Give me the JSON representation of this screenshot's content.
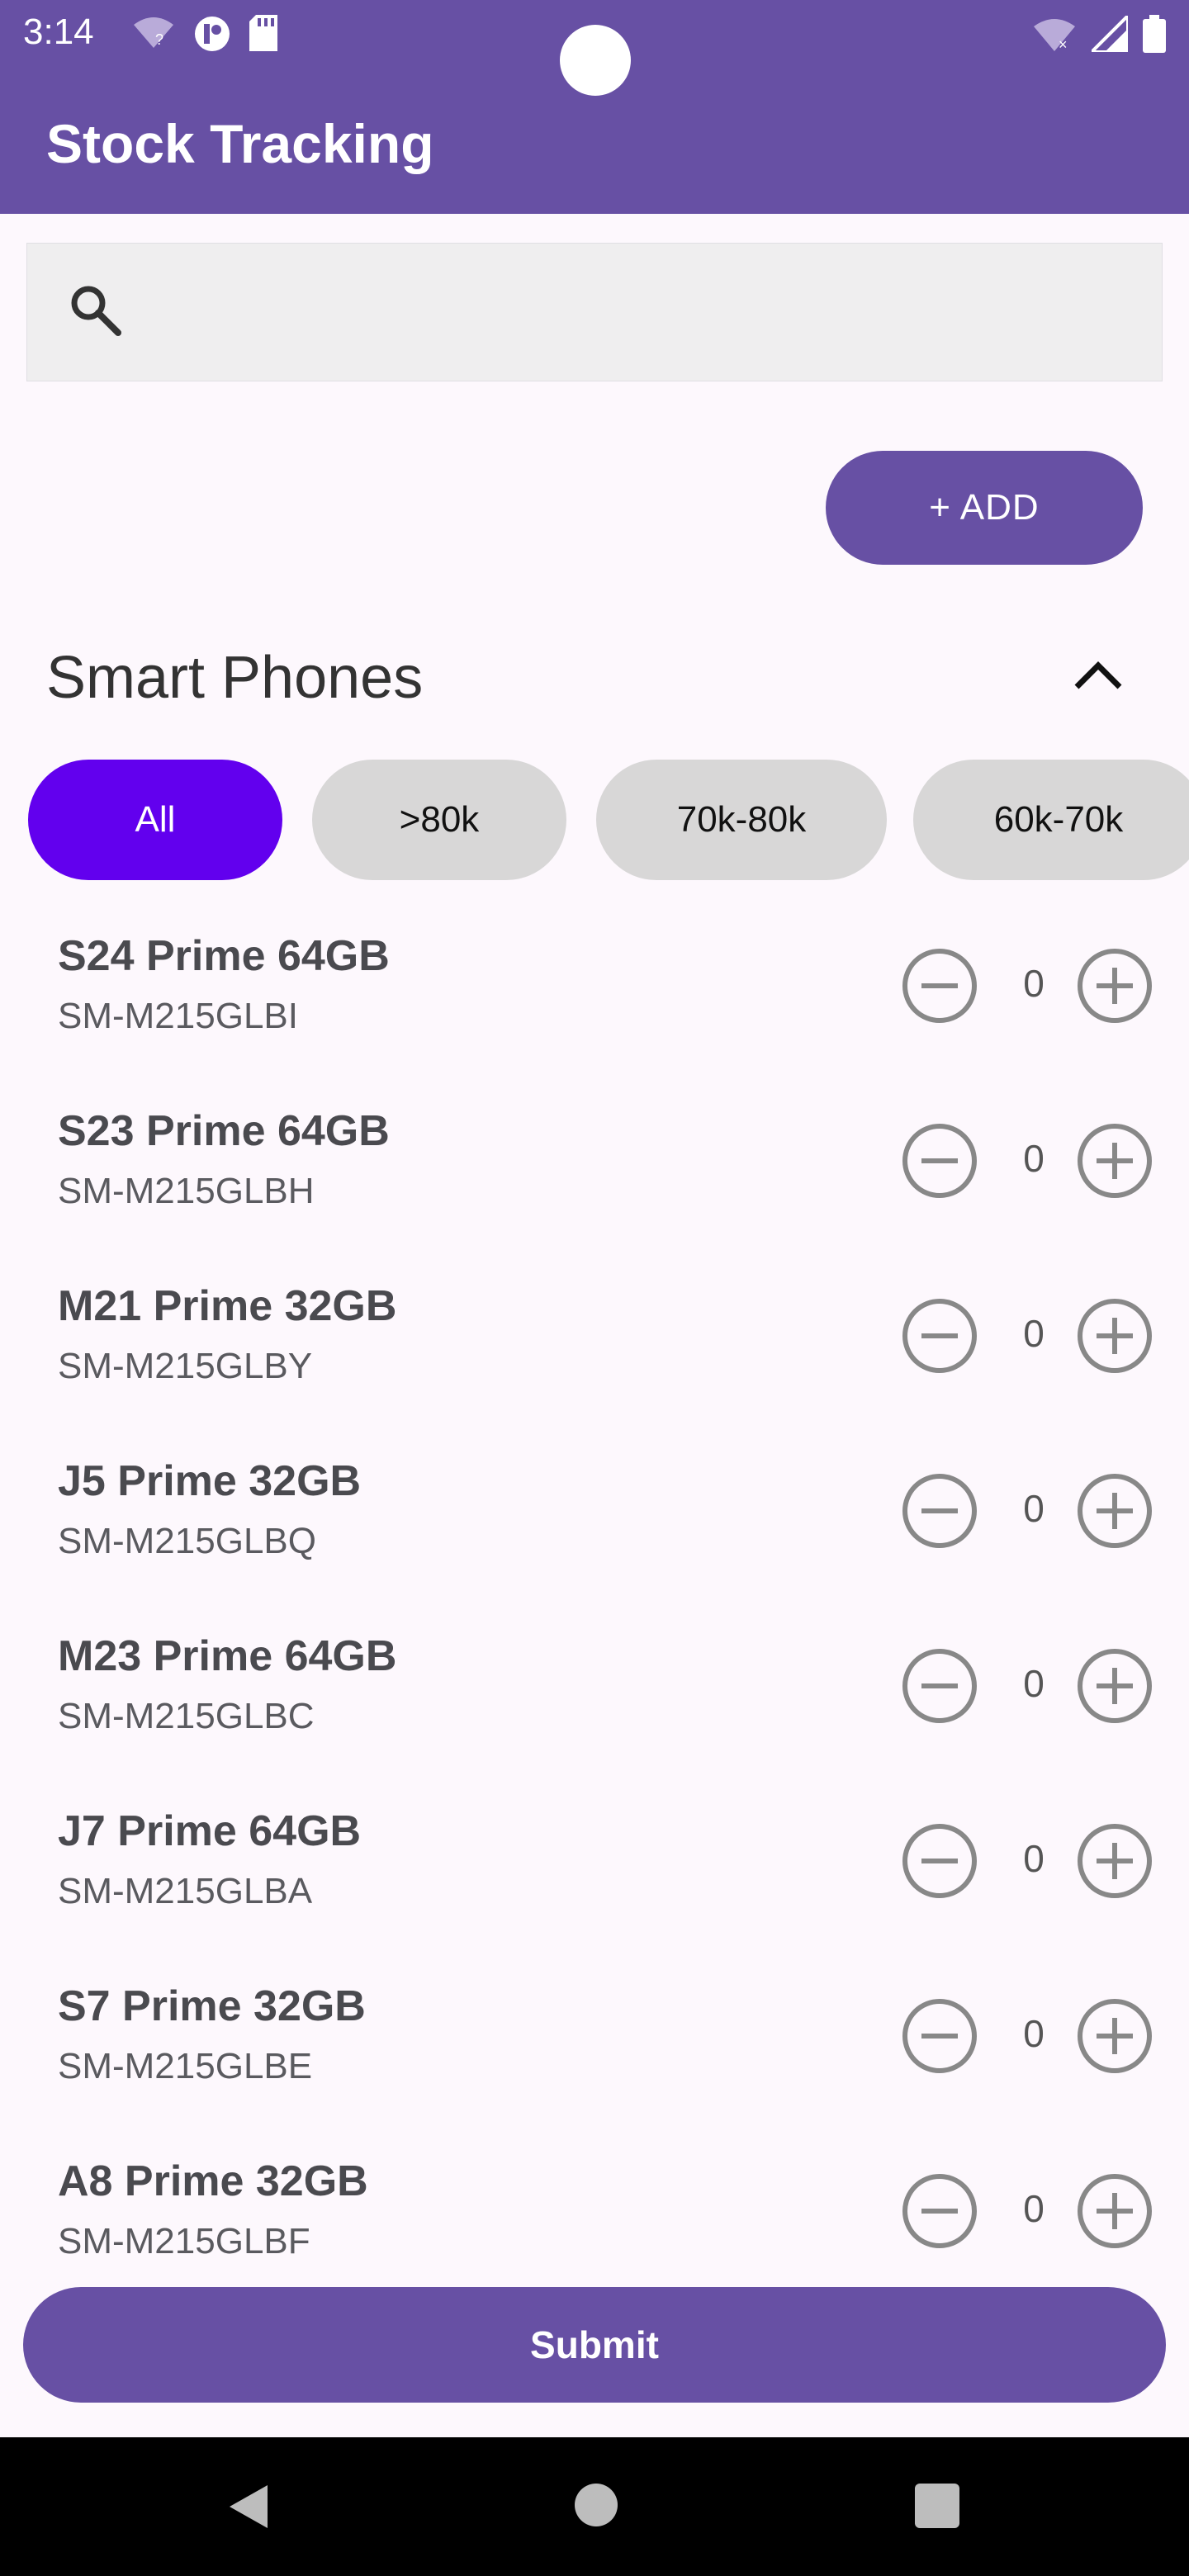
{
  "status_bar": {
    "time": "3:14",
    "icons_left": [
      "wifi-question-icon",
      "app-badge-icon",
      "sd-card-icon"
    ],
    "icons_right": [
      "wifi-off-icon",
      "signal-icon",
      "battery-icon"
    ]
  },
  "app_bar": {
    "title": "Stock Tracking",
    "color": "#6750a4"
  },
  "search": {
    "placeholder": "",
    "value": ""
  },
  "add_button": {
    "label": "+ ADD"
  },
  "section": {
    "title": "Smart Phones",
    "expanded": true
  },
  "filters": {
    "chips": [
      {
        "label": "All",
        "selected": true
      },
      {
        "label": ">80k",
        "selected": false
      },
      {
        "label": "70k-80k",
        "selected": false
      },
      {
        "label": "60k-70k",
        "selected": false
      }
    ],
    "active_color": "#6200ee"
  },
  "products": [
    {
      "name": "S24 Prime 64GB",
      "sku": "SM-M215GLBI",
      "qty": "0"
    },
    {
      "name": "S23 Prime 64GB",
      "sku": "SM-M215GLBH",
      "qty": "0"
    },
    {
      "name": "M21 Prime 32GB",
      "sku": "SM-M215GLBY",
      "qty": "0"
    },
    {
      "name": "J5 Prime 32GB",
      "sku": "SM-M215GLBQ",
      "qty": "0"
    },
    {
      "name": "M23 Prime 64GB",
      "sku": "SM-M215GLBC",
      "qty": "0"
    },
    {
      "name": "J7 Prime 64GB",
      "sku": "SM-M215GLBA",
      "qty": "0"
    },
    {
      "name": "S7 Prime 32GB",
      "sku": "SM-M215GLBE",
      "qty": "0"
    },
    {
      "name": "A8 Prime 32GB",
      "sku": "SM-M215GLBF",
      "qty": "0"
    }
  ],
  "submit_button": {
    "label": "Submit"
  }
}
